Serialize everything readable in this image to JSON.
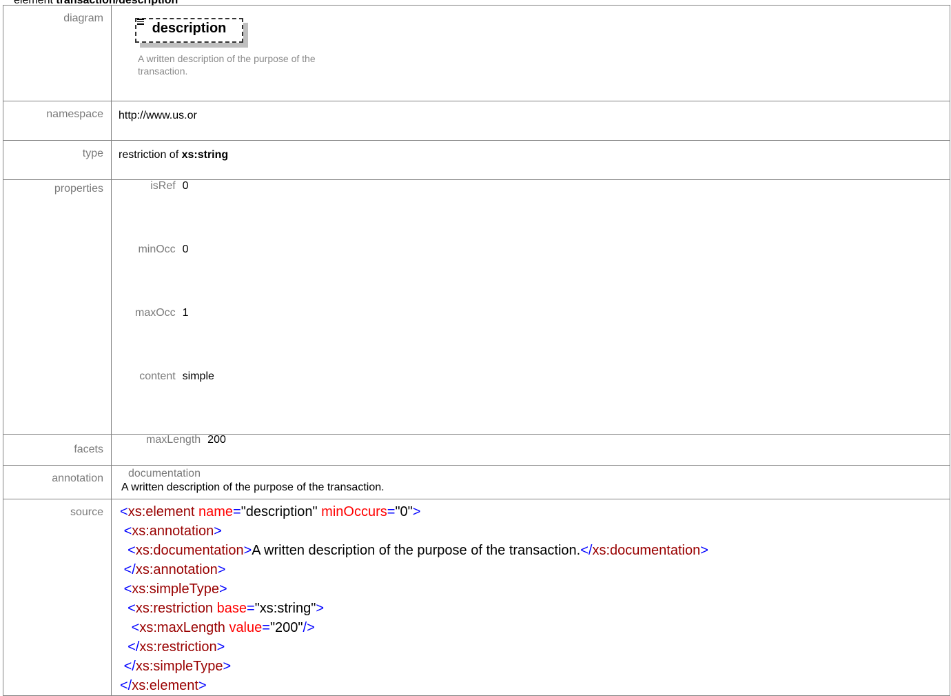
{
  "header": {
    "prefix": "element ",
    "name": "transaction/description"
  },
  "rows": {
    "diagram": {
      "label": "diagram",
      "element_name": "description",
      "doc_text": "A written description of the purpose of the transaction.",
      "icon": "documentation-lines-icon"
    },
    "namespace": {
      "label": "namespace",
      "value": "http://www.us.or"
    },
    "type": {
      "label": "type",
      "prefix": "restriction of ",
      "base": "xs:string"
    },
    "properties": {
      "label": "properties",
      "items": [
        {
          "key": "isRef",
          "value": "0"
        },
        {
          "key": "minOcc",
          "value": "0"
        },
        {
          "key": "maxOcc",
          "value": "1"
        },
        {
          "key": "content",
          "value": "simple"
        }
      ]
    },
    "facets": {
      "label": "facets",
      "key": "maxLength",
      "value": "200"
    },
    "annotation": {
      "label": "annotation",
      "title": "documentation",
      "text": "A written description of the purpose of the transaction."
    },
    "source": {
      "label": "source",
      "line1": {
        "open": "<",
        "tag": "xs:element",
        "a1": "name",
        "eq": "=",
        "v1": "\"description\"",
        "a2": "minOccurs",
        "v2": "\"0\"",
        "close": ">"
      },
      "line2": {
        "indent": " ",
        "open": "<",
        "tag": "xs:annotation",
        "close": ">"
      },
      "line3": {
        "indent": "  ",
        "open": "<",
        "tag": "xs:documentation",
        "close": ">",
        "text": "A written description of the purpose of the transaction.",
        "endopen": "</",
        "endtag": "xs:documentation",
        "endclose": ">"
      },
      "line4": {
        "indent": " ",
        "open": "</",
        "tag": "xs:annotation",
        "close": ">"
      },
      "line5": {
        "indent": " ",
        "open": "<",
        "tag": "xs:simpleType",
        "close": ">"
      },
      "line6": {
        "indent": "  ",
        "open": "<",
        "tag": "xs:restriction",
        "a1": "base",
        "eq": "=",
        "v1": "\"xs:string\"",
        "close": ">"
      },
      "line7": {
        "indent": "   ",
        "open": "<",
        "tag": "xs:maxLength",
        "a1": "value",
        "eq": "=",
        "v1": "\"200\"",
        "close": "/>"
      },
      "line8": {
        "indent": "  ",
        "open": "</",
        "tag": "xs:restriction",
        "close": ">"
      },
      "line9": {
        "indent": " ",
        "open": "</",
        "tag": "xs:simpleType",
        "close": ">"
      },
      "line10": {
        "open": "</",
        "tag": "xs:element",
        "close": ">"
      }
    }
  },
  "colors": {
    "tag_bracket": "#0000ff",
    "tag_name": "#990000",
    "attr_name": "#ff0000",
    "label_gray": "#7a7a7a",
    "border": "#808080"
  }
}
